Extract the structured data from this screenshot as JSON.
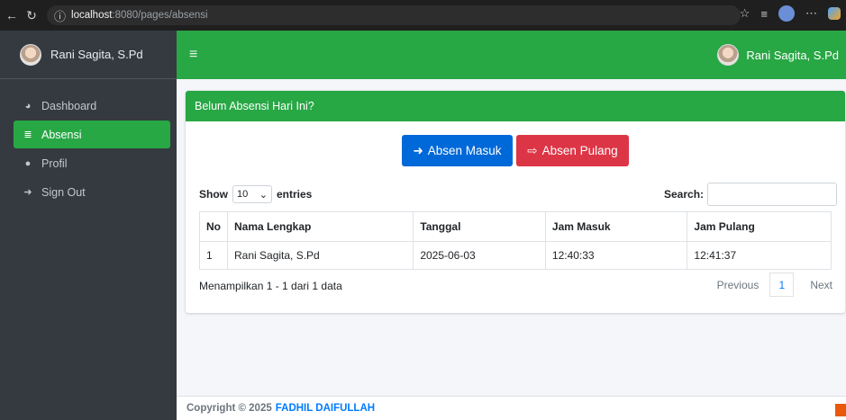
{
  "browser": {
    "url_host": "localhost",
    "url_path": ":8080/pages/absensi"
  },
  "sidebar": {
    "brand_name": "Rani Sagita, S.Pd",
    "items": [
      {
        "label": "Dashboard",
        "icon": "tachometer-icon",
        "active": false
      },
      {
        "label": "Absensi",
        "icon": "database-icon",
        "active": true
      },
      {
        "label": "Profil",
        "icon": "user-icon",
        "active": false
      },
      {
        "label": "Sign Out",
        "icon": "sign-out-icon",
        "active": false
      }
    ]
  },
  "topbar": {
    "user_name": "Rani Sagita, S.Pd"
  },
  "card": {
    "title": "Belum Absensi Hari Ini?",
    "btn_in": "Absen Masuk",
    "btn_out": "Absen Pulang"
  },
  "table_controls": {
    "show_label": "Show",
    "entries_value": "10",
    "entries_label": "entries",
    "search_label": "Search:"
  },
  "table": {
    "headers": [
      "No",
      "Nama Lengkap",
      "Tanggal",
      "Jam Masuk",
      "Jam Pulang"
    ],
    "rows": [
      [
        "1",
        "Rani Sagita, S.Pd",
        "2025-06-03",
        "12:40:33",
        "12:41:37"
      ]
    ]
  },
  "info": "Menampilkan 1 - 1 dari 1 data",
  "pagination": {
    "previous": "Previous",
    "page": "1",
    "next": "Next"
  },
  "footer": {
    "text": "Copyright © 2025",
    "link": "FADHIL DAIFULLAH"
  },
  "colors": {
    "green": "#28a745",
    "blue": "#0069d9",
    "red": "#dc3545",
    "sidebar": "#343a40"
  }
}
